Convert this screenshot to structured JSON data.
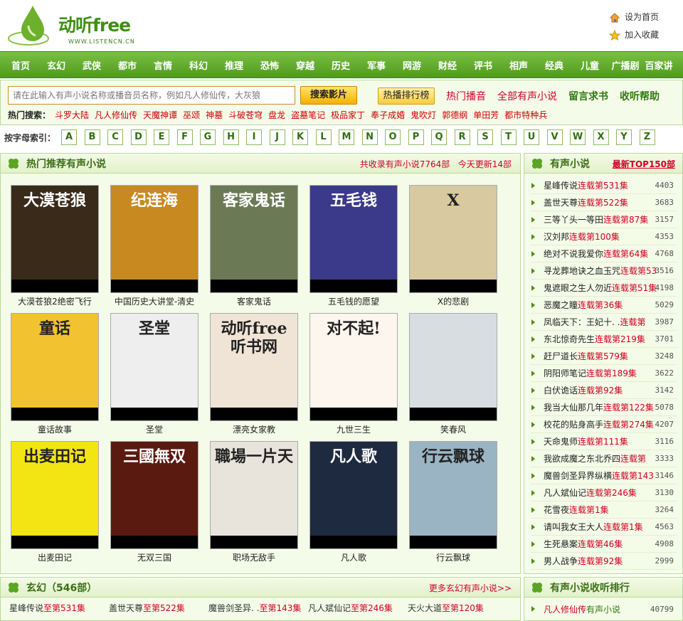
{
  "header": {
    "logo_text": "动听free",
    "logo_url": "WWW.LISTENCN.CN",
    "set_home": "设为首页",
    "add_favorite": "加入收藏"
  },
  "nav": [
    "首页",
    "玄幻",
    "武侠",
    "都市",
    "言情",
    "科幻",
    "推理",
    "恐怖",
    "穿越",
    "历史",
    "军事",
    "网游",
    "财经",
    "评书",
    "相声",
    "经典",
    "儿童",
    "广播剧",
    "百家讲"
  ],
  "search": {
    "placeholder": "请在此输入有声小说名称或播音员名称，例如凡人修仙传，大灰狼",
    "button": "搜索影片",
    "rank_button": "热播排行榜",
    "links": [
      "热门播音",
      "全部有声小说",
      "留言求书",
      "收听帮助"
    ],
    "hot_label": "热门搜索：",
    "hot": [
      "斗罗大陆",
      "凡人修仙传",
      "天魔神谭",
      "巫颂",
      "神墓",
      "斗破苍穹",
      "盘龙",
      "盗墓笔记",
      "极品家丁",
      "奉子成婚",
      "鬼吹灯",
      "郭德纲",
      "单田芳",
      "都市特种兵"
    ]
  },
  "alpha": {
    "label": "按字母索引：",
    "letters": [
      "A",
      "B",
      "C",
      "D",
      "E",
      "F",
      "G",
      "H",
      "I",
      "J",
      "K",
      "L",
      "M",
      "N",
      "O",
      "P",
      "Q",
      "R",
      "S",
      "T",
      "U",
      "V",
      "W",
      "X",
      "Y",
      "Z"
    ]
  },
  "recommend": {
    "title": "热门推荐有声小说",
    "total": "共收录有声小说7764部",
    "today": "今天更新14部",
    "books": [
      {
        "title": "大漠苍狼2绝密飞行",
        "cover": "大漠苍狼",
        "color": "#3a2a1a"
      },
      {
        "title": "中国历史大讲堂-清史",
        "cover": "纪连海",
        "color": "#c88a20"
      },
      {
        "title": "客家鬼话",
        "cover": "客家鬼话",
        "color": "#6b7a55"
      },
      {
        "title": "五毛钱的愿望",
        "cover": "五毛钱",
        "color": "#3b3a8a"
      },
      {
        "title": "X的悲剧",
        "cover": "X",
        "color": "#d9c9a0"
      },
      {
        "title": "童话故事",
        "cover": "童话",
        "color": "#f2c230"
      },
      {
        "title": "圣堂",
        "cover": "圣堂",
        "color": "#eeeeee"
      },
      {
        "title": "漂亮女家教",
        "cover": "动听free听书网",
        "color": "#f0e4d6"
      },
      {
        "title": "九世三生",
        "cover": "对不起!",
        "color": "#fdf6ef"
      },
      {
        "title": "笑春风",
        "cover": "",
        "color": "#d8dde2"
      },
      {
        "title": "出麦田记",
        "cover": "出麦田记",
        "color": "#f3e414"
      },
      {
        "title": "无双三国",
        "cover": "三國無双",
        "color": "#5a1a10"
      },
      {
        "title": "职场无敌手",
        "cover": "職場一片天",
        "color": "#e8e4dc"
      },
      {
        "title": "凡人歌",
        "cover": "凡人歌",
        "color": "#1d2a40"
      },
      {
        "title": "行云飘球",
        "cover": "行云飘球",
        "color": "#9bb4c4"
      }
    ]
  },
  "sidebar": {
    "title": "有声小说",
    "top_link": "最新TOP150部",
    "items": [
      {
        "name": "星峰传说",
        "status": "连载第531集",
        "count": "4403"
      },
      {
        "name": "盖世天尊",
        "status": "连载第522集",
        "count": "3683"
      },
      {
        "name": "三等丫头一等田",
        "status": "连载第87集",
        "count": "3157"
      },
      {
        "name": "汉刘邦",
        "status": "连载第100集",
        "count": "4353"
      },
      {
        "name": "绝对不说我爱你",
        "status": "连载第64集",
        "count": "4768"
      },
      {
        "name": "寻龙葬地诀之血玉咒",
        "status": "连载第53",
        "count": "3516"
      },
      {
        "name": "鬼遮眼之生人勿近",
        "status": "连载第51集",
        "count": "4198"
      },
      {
        "name": "恶魔之瞳",
        "status": "连载第36集",
        "count": "5029"
      },
      {
        "name": "凤临天下：王妃十. .",
        "status": "连载第",
        "count": "3987"
      },
      {
        "name": "东北惊奇先生",
        "status": "连载第219集",
        "count": "3701"
      },
      {
        "name": "赶尸道长",
        "status": "连载第579集",
        "count": "3248"
      },
      {
        "name": "阴阳师笔记",
        "status": "连载第189集",
        "count": "3622"
      },
      {
        "name": "白伏诡话",
        "status": "连载第92集",
        "count": "3142"
      },
      {
        "name": "我当大仙那几年",
        "status": "连载第122集",
        "count": "5078"
      },
      {
        "name": "校花的贴身高手",
        "status": "连载第274集",
        "count": "4207"
      },
      {
        "name": "天命鬼师",
        "status": "连载第111集",
        "count": "3116"
      },
      {
        "name": "我欲成魔之东北乔四",
        "status": "连载第",
        "count": "3333"
      },
      {
        "name": "魔兽剑圣异界纵横",
        "status": "连载第143",
        "count": "3146"
      },
      {
        "name": "凡人斌仙记",
        "status": "连载第246集",
        "count": "3130"
      },
      {
        "name": "花雪夜",
        "status": "连载第1集",
        "count": "3264"
      },
      {
        "name": "请叫我女王大人",
        "status": "连载第1集",
        "count": "4563"
      },
      {
        "name": "生死悬案",
        "status": "连载第46集",
        "count": "4908"
      },
      {
        "name": "男人战争",
        "status": "连载第92集",
        "count": "2999"
      }
    ]
  },
  "xuanhuan": {
    "title": "玄幻（546部）",
    "more": "更多玄幻有声小说>>",
    "items": [
      {
        "name": "星峰传说",
        "status": "至第531集"
      },
      {
        "name": "盖世天尊",
        "status": "至第522集"
      },
      {
        "name": "魔兽剑圣异. .",
        "status": "至第143集"
      },
      {
        "name": "凡人斌仙记",
        "status": "至第246集"
      },
      {
        "name": "天火大道",
        "status": "至第120集"
      }
    ]
  },
  "rank": {
    "title": "有声小说收听排行",
    "items": [
      {
        "name": "凡人修仙传",
        "status": "有声小说",
        "count": "40799"
      }
    ]
  }
}
